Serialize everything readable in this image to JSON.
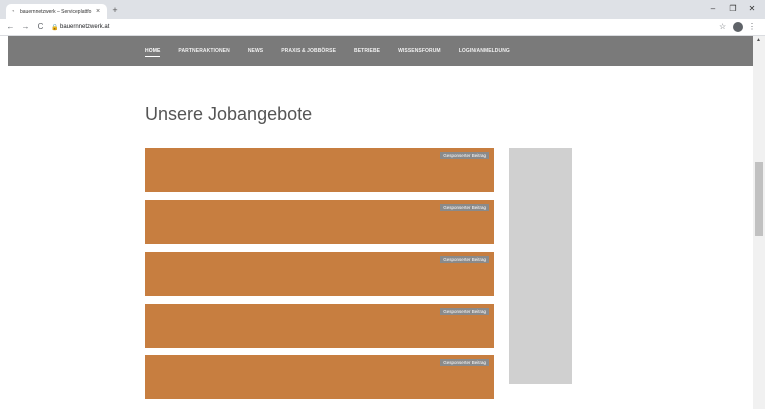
{
  "browser": {
    "tab": {
      "title": "bauernnetzwerk – Serviceplattfo",
      "close_glyph": "×"
    },
    "new_tab_glyph": "+",
    "window_controls": {
      "minimize": "–",
      "restore": "❐",
      "close": "✕"
    },
    "nav": {
      "back": "←",
      "forward": "→",
      "reload": "C"
    },
    "url": "bauernnetzwerk.at",
    "lock_glyph": "🔒",
    "star_glyph": "☆",
    "profile_initial": "",
    "menu_glyph": "⋮"
  },
  "site": {
    "nav_items": [
      {
        "label": "HOME",
        "active": true
      },
      {
        "label": "PARTNERAKTIONEN"
      },
      {
        "label": "NEWS"
      },
      {
        "label": "PRAXIS & JOBBÖRSE"
      },
      {
        "label": "BETRIEBE"
      },
      {
        "label": "WISSENSFORUM"
      },
      {
        "label": "LOGIN/ANMELDUNG"
      }
    ],
    "page_title": "Unsere Jobangebote",
    "jobs": [
      {
        "badge": "Gesponserter Beitrag"
      },
      {
        "badge": "Gesponserter Beitrag"
      },
      {
        "badge": "Gesponserter Beitrag"
      },
      {
        "badge": "Gesponserter Beitrag"
      },
      {
        "badge": "Gesponserter Beitrag"
      }
    ]
  },
  "colors": {
    "header": "#7a7a7a",
    "job_card": "#c77e40",
    "badge": "#8a8a8a",
    "sidebar": "#d0d0d0",
    "title": "#555555"
  }
}
